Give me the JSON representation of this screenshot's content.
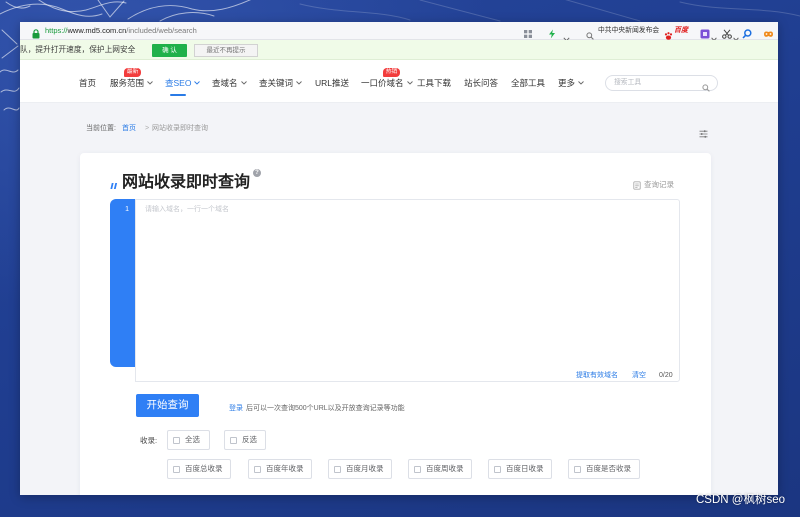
{
  "colors": {
    "desktop_bg": "#1f3d8f",
    "accent_blue": "#2f7ff5",
    "link_blue": "#2a7be6",
    "badge_red": "#f23d3d",
    "confirm_green": "#20b14a",
    "notice_bg": "#f0fbe8",
    "content_bg": "#f3f4f8"
  },
  "browser": {
    "address": {
      "scheme": "https://",
      "domain": "www.md5.com.cn",
      "path": "/included/web/search"
    },
    "search": {
      "query": "中共中央新闻发布会",
      "engine": "百度"
    },
    "icons": [
      "lock-icon",
      "apps-icon",
      "lightning-icon",
      "chevron-down-icon",
      "search-icon",
      "baidu-paw-icon",
      "extension-icon",
      "scissors-icon",
      "magnifier-icon",
      "game-icon"
    ]
  },
  "notice_bar": {
    "message": "队，提升打开速度，保护上网安全",
    "confirm_label": "确 认",
    "dismiss_label": "最近不再提示"
  },
  "nav": {
    "items": [
      {
        "label": "首页"
      },
      {
        "label": "服务范围",
        "badge": "最新",
        "has_dropdown": true
      },
      {
        "label": "查SEO",
        "has_dropdown": true,
        "active": true
      },
      {
        "label": "查域名",
        "has_dropdown": true
      },
      {
        "label": "查关键词",
        "has_dropdown": true
      },
      {
        "label": "URL推送"
      },
      {
        "label": "一口价域名",
        "badge": "热销",
        "has_dropdown": true
      },
      {
        "label": "工具下载"
      },
      {
        "label": "站长问答"
      },
      {
        "label": "全部工具"
      },
      {
        "label": "更多",
        "has_dropdown": true
      }
    ],
    "search_placeholder": "搜索工具"
  },
  "breadcrumb": {
    "prefix": "当前位置:",
    "home": "首页",
    "separator": ">",
    "current": "网站收录即时查询"
  },
  "tool": {
    "title": "网站收录即时查询",
    "help_symbol": "?",
    "history_label": "查询记录",
    "line_number": "1",
    "textarea_placeholder": "请输入域名，一行一个域名",
    "extract_label": "提取有效域名",
    "clear_label": "清空",
    "counter": "0/20",
    "submit_label": "开始查询",
    "login_link": "登录",
    "login_hint": "后可以一次查询500个URL以及开放查询记录等功能",
    "filter_label": "收录:",
    "select_all_label": "全选",
    "invert_label": "反选",
    "options": [
      "百度总收录",
      "百度年收录",
      "百度月收录",
      "百度周收录",
      "百度日收录",
      "百度是否收录"
    ]
  },
  "watermark": "CSDN @枫树seo"
}
